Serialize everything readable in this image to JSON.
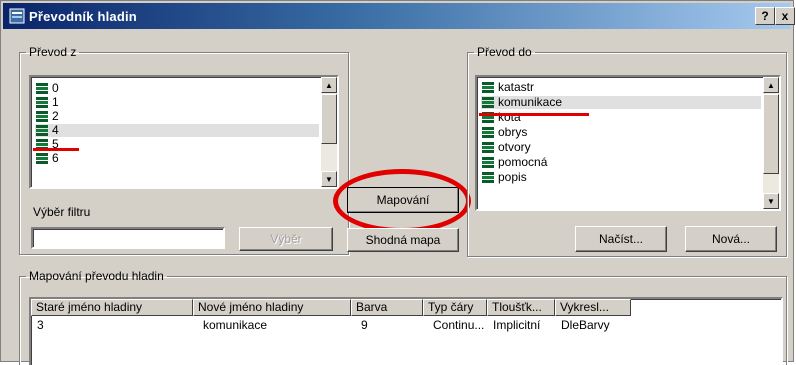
{
  "window": {
    "title": "Převodník hladin",
    "help_label": "?",
    "close_label": "x"
  },
  "source": {
    "legend": "Převod z",
    "items": [
      "0",
      "1",
      "2",
      "4",
      "5",
      "6"
    ],
    "selected_item": "4"
  },
  "target": {
    "legend": "Převod do",
    "items": [
      "katastr",
      "komunikace",
      "kota",
      "obrys",
      "otvory",
      "pomocná",
      "popis"
    ],
    "selected_item": "komunikace"
  },
  "filter": {
    "label": "Výběr filtru",
    "value": "",
    "select_button": "Výběr"
  },
  "buttons": {
    "mapping": "Mapování",
    "same_map": "Shodná mapa",
    "load": "Načíst...",
    "new": "Nová..."
  },
  "mapping_table": {
    "legend": "Mapování převodu hladin",
    "columns": [
      "Staré jméno hladiny",
      "Nové jméno hladiny",
      "Barva",
      "Typ čáry",
      "Tloušťk...",
      "Vykresl..."
    ],
    "rows": [
      [
        "3",
        "komunikace",
        "9",
        "Continu...",
        "Implicitní",
        "DleBarvy"
      ]
    ]
  },
  "colors": {
    "annotation": "#e00000",
    "title_start": "#0a246a"
  }
}
